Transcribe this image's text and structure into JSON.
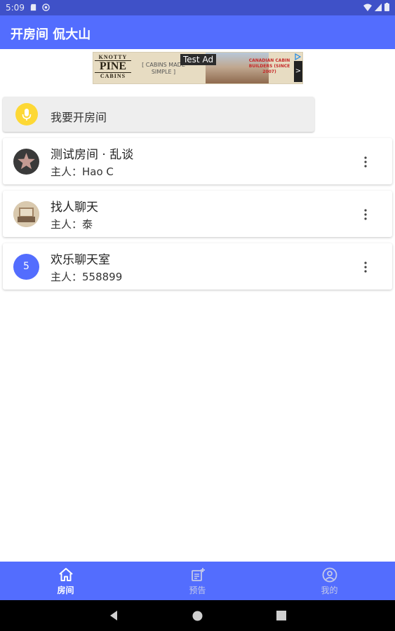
{
  "status_bar": {
    "time": "5:09",
    "icons_left": [
      "sd-card-icon",
      "sync-icon"
    ],
    "icons_right": [
      "wifi-icon",
      "signal-icon",
      "battery-icon"
    ]
  },
  "app_bar": {
    "title": "开房间 侃大山"
  },
  "ad": {
    "logo_line1": "KNOTTY",
    "logo_line2": "PINE",
    "logo_line3": "CABINS",
    "tagline": "[ CABINS MADE SIMPLE ]",
    "test_label": "Test Ad",
    "brand": "CANADIAN CABIN BUILDERS (SINCE 2007)",
    "arrow": ">"
  },
  "create_room": {
    "label": "我要开房间"
  },
  "rooms": [
    {
      "name": "测试房间 · 乱谈",
      "owner": "主人：Hao C",
      "avatar": "star-avatar"
    },
    {
      "name": "找人聊天",
      "owner": "主人：泰",
      "avatar": "photo-avatar"
    },
    {
      "name": "欢乐聊天室",
      "owner": "主人：558899",
      "avatar_text": "5"
    }
  ],
  "bottom_nav": {
    "items": [
      {
        "label": "房间",
        "icon": "home-icon",
        "active": true
      },
      {
        "label": "预告",
        "icon": "post-add-icon",
        "active": false
      },
      {
        "label": "我的",
        "icon": "account-circle-icon",
        "active": false
      }
    ]
  },
  "colors": {
    "primary": "#536dfe",
    "status_bar": "#3f51c8",
    "mic_yellow": "#fdd835"
  }
}
